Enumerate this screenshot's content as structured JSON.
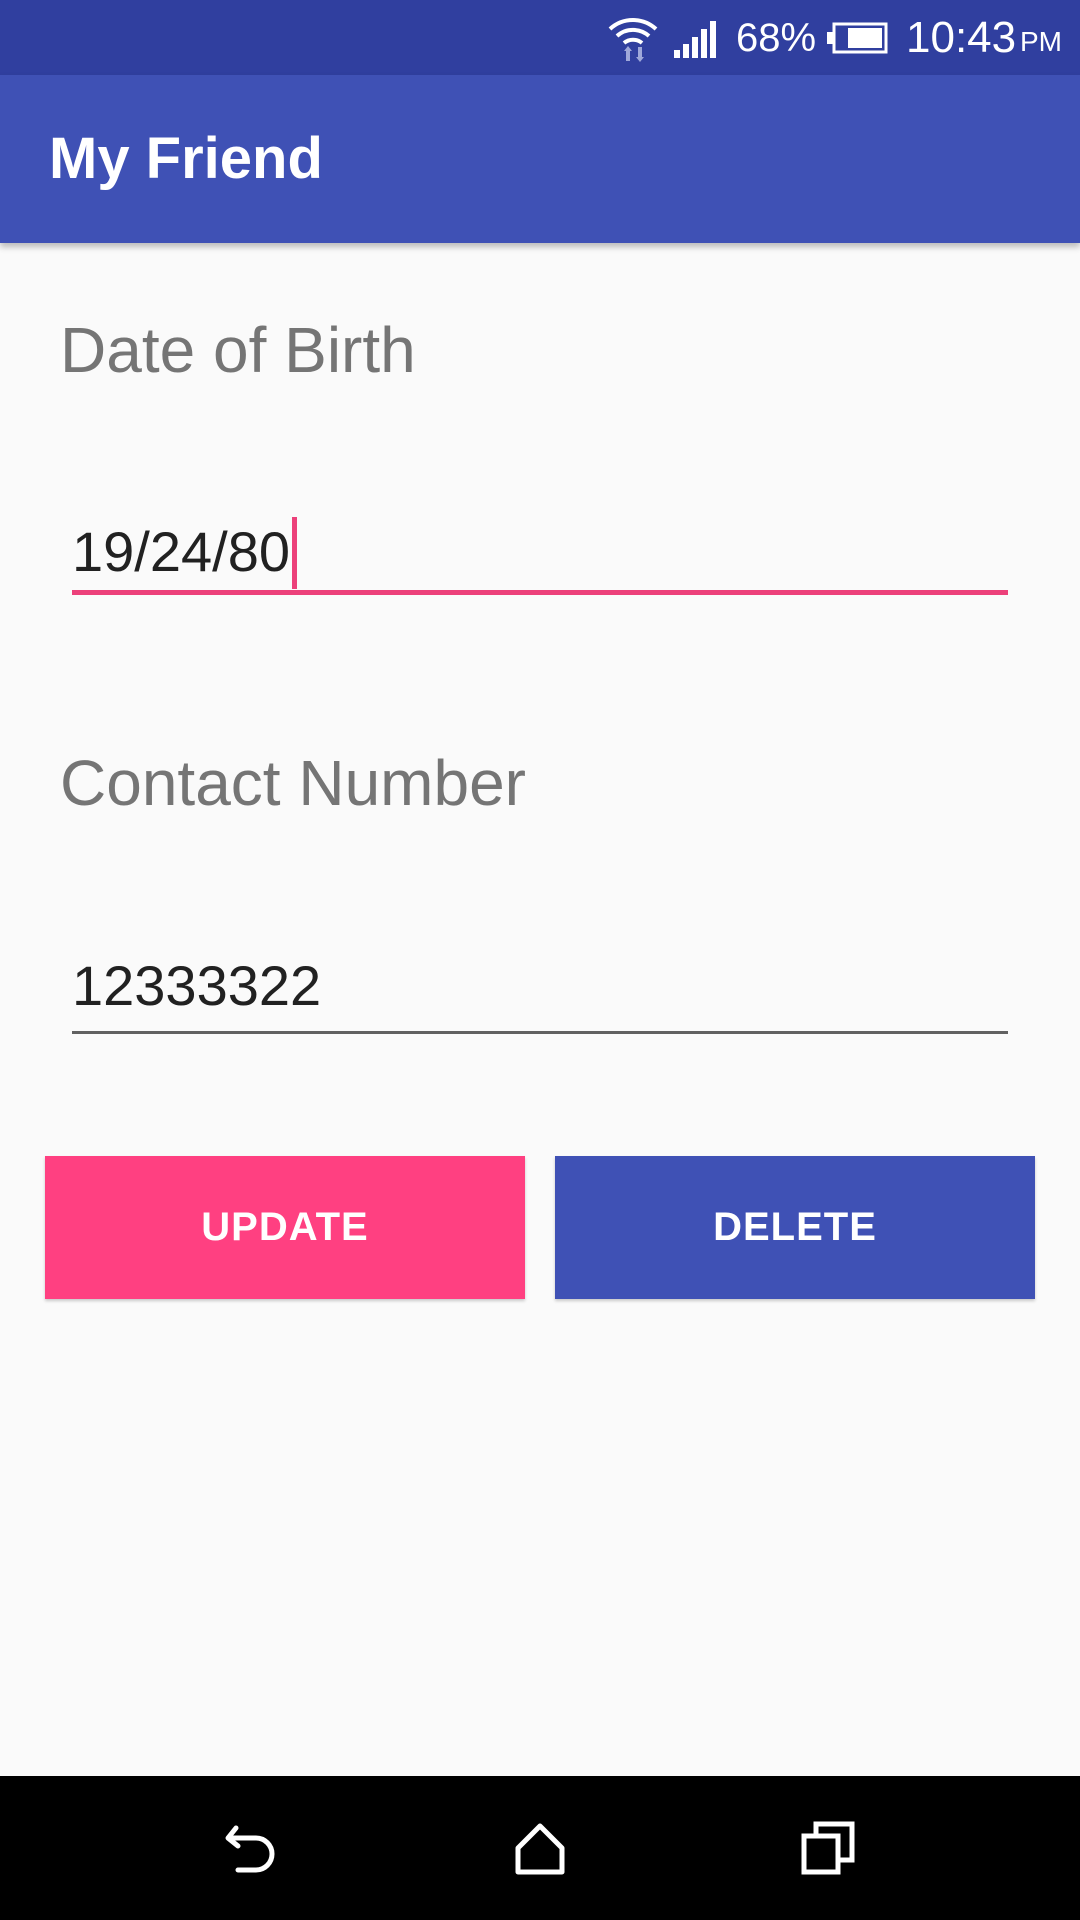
{
  "status_bar": {
    "battery_percent": "68%",
    "time": "10:43",
    "ampm": "PM",
    "icons": [
      "wifi-icon",
      "signal-icon",
      "battery-icon"
    ]
  },
  "app_bar": {
    "title": "My Friend"
  },
  "form": {
    "dob_label": "Date of Birth",
    "dob_value": "19/24/80",
    "contact_label": "Contact Number",
    "contact_value": "12333322"
  },
  "buttons": {
    "update_label": "UPDATE",
    "delete_label": "DELETE"
  },
  "nav_bar": {
    "icons": [
      "back-icon",
      "home-icon",
      "recents-icon"
    ]
  },
  "colors": {
    "primary": "#3f51b5",
    "primary_dark": "#303f9f",
    "accent": "#ff4081",
    "background": "#fafafa"
  }
}
